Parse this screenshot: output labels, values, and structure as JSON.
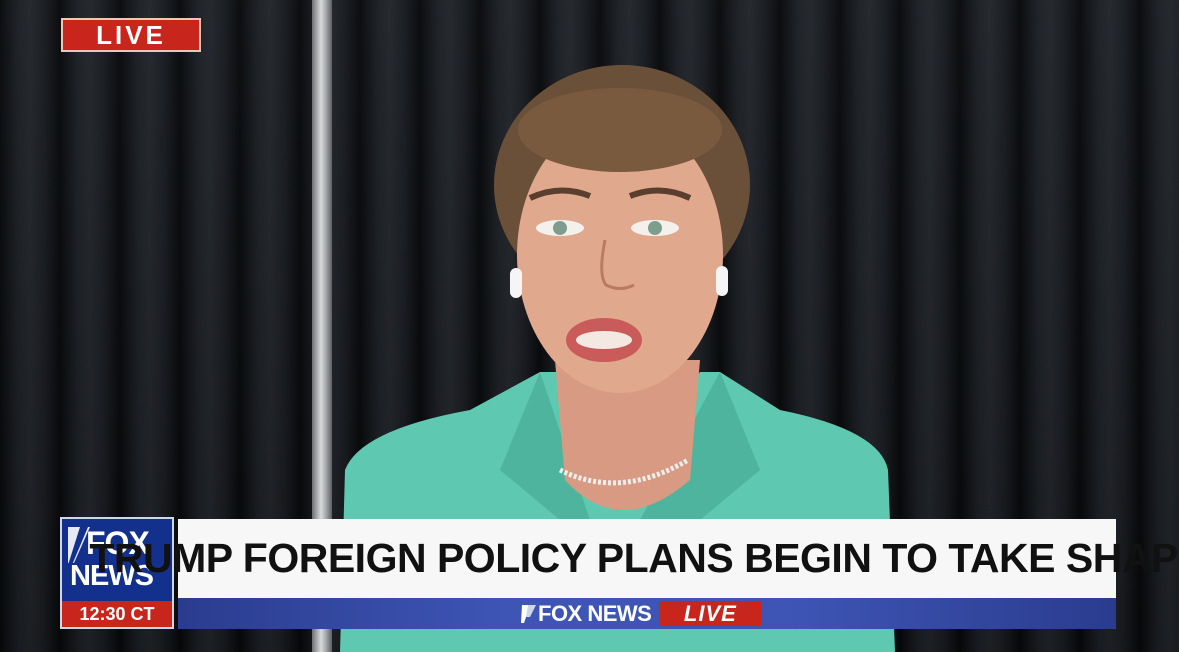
{
  "badge": {
    "live": "LIVE"
  },
  "logo": {
    "line1": "FOX",
    "line2": "NEWS",
    "time": "12:30 CT"
  },
  "lower_third": {
    "headline": "TRUMP FOREIGN POLICY PLANS BEGIN TO TAKE SHAPE",
    "brand": "FOX NEWS",
    "live": "LIVE"
  },
  "colors": {
    "live_red": "#c8261d",
    "brand_blue": "#13318c",
    "bar_blue": "#3e55b5",
    "jacket_teal": "#5fc8b0"
  }
}
